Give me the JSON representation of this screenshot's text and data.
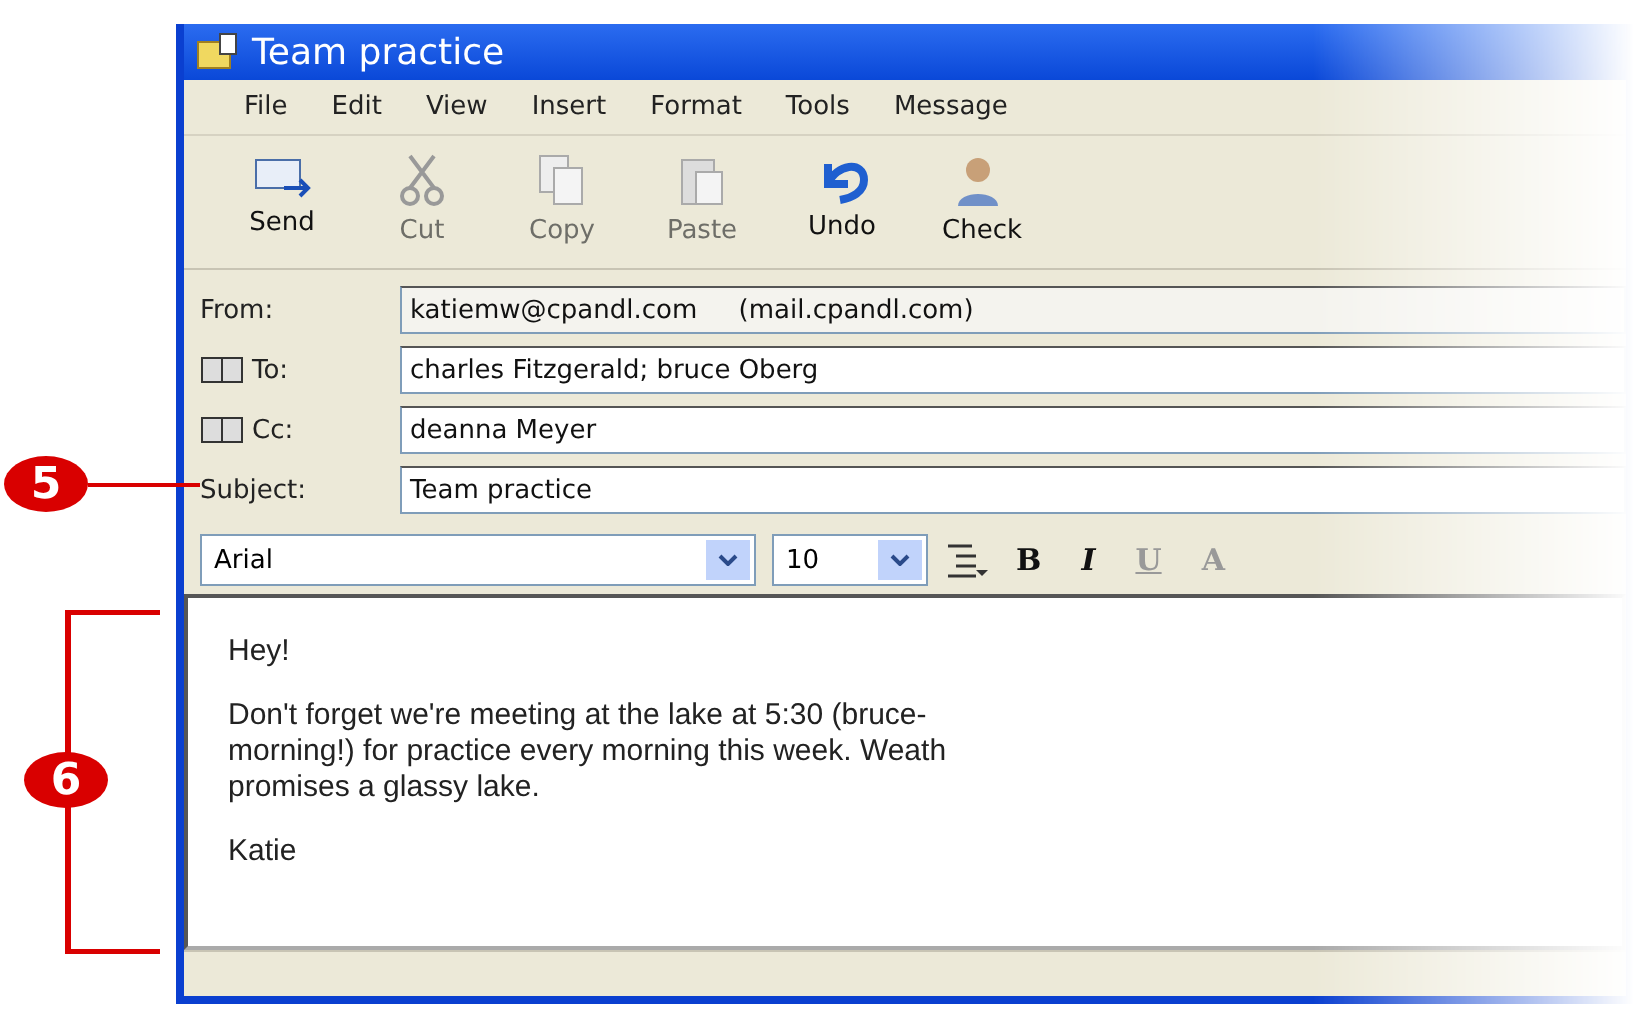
{
  "window": {
    "title": "Team practice"
  },
  "menu": [
    "File",
    "Edit",
    "View",
    "Insert",
    "Format",
    "Tools",
    "Message"
  ],
  "toolbar": [
    {
      "label": "Send",
      "kind": "send",
      "disabled": false
    },
    {
      "label": "Cut",
      "kind": "cut",
      "disabled": true
    },
    {
      "label": "Copy",
      "kind": "copy",
      "disabled": true
    },
    {
      "label": "Paste",
      "kind": "paste",
      "disabled": true
    },
    {
      "label": "Undo",
      "kind": "undo",
      "disabled": false
    },
    {
      "label": "Check",
      "kind": "check",
      "disabled": false
    }
  ],
  "headers": [
    {
      "label": "From:",
      "value": "katiemw@cpandl.com     (mail.cpandl.com)",
      "kind": "from"
    },
    {
      "label": "To:",
      "value": "charles Fitzgerald; bruce Oberg",
      "kind": "address"
    },
    {
      "label": "Cc:",
      "value": "deanna Meyer",
      "kind": "address"
    },
    {
      "label": "Subject:",
      "value": "Team practice",
      "kind": "subject"
    }
  ],
  "format_bar": {
    "font": "Arial",
    "size": "10",
    "buttons": [
      "B",
      "I",
      "U",
      "A"
    ]
  },
  "body": {
    "paragraphs": [
      "Hey!",
      "Don't forget we're meeting at the lake at 5:30 (bruce-",
      "morning!) for practice every morning this week. Weath",
      "promises a glassy lake.",
      "Katie"
    ]
  },
  "callouts": [
    {
      "number": "5",
      "kind": "point"
    },
    {
      "number": "6",
      "kind": "bracket"
    }
  ]
}
